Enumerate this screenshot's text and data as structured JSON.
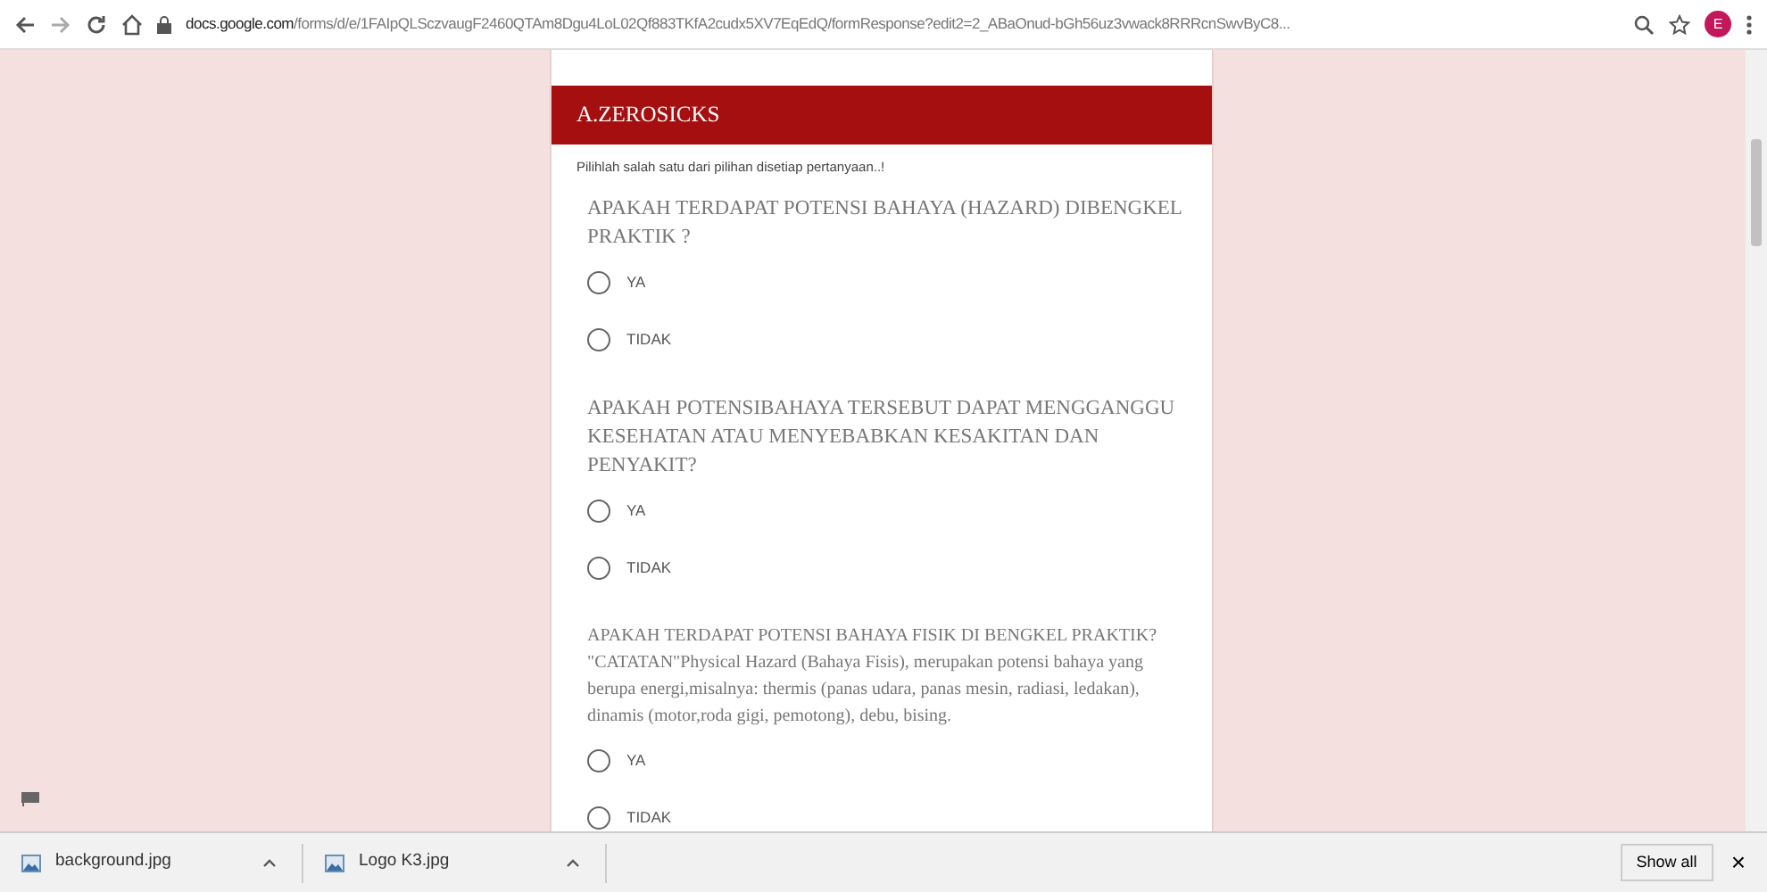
{
  "browser": {
    "url_host": "docs.google.com",
    "url_path": "/forms/d/e/1FAIpQLSczvaugF2460QTAm8Dgu4LoL02Qf883TKfA2cudx5XV7EqEdQ/formResponse?edit2=2_ABaOnud-bGh56uz3vwack8RRRcnSwvByC8...",
    "profile_initial": "E"
  },
  "form": {
    "section_title": "A.ZEROSICKS",
    "instruction": "Pilihlah salah satu dari pilihan disetiap pertanyaan..!",
    "questions": [
      {
        "text": "APAKAH TERDAPAT POTENSI BAHAYA (HAZARD) DIBENGKEL PRAKTIK ?",
        "options": [
          {
            "label": "YA",
            "selected": false
          },
          {
            "label": "TIDAK",
            "selected": false
          }
        ]
      },
      {
        "text": "APAKAH POTENSIBAHAYA TERSEBUT DAPAT MENGGANGGU KESEHATAN ATAU MENYEBABKAN KESAKITAN DAN PENYAKIT?",
        "options": [
          {
            "label": "YA",
            "selected": false
          },
          {
            "label": "TIDAK",
            "selected": false
          }
        ]
      },
      {
        "text": "APAKAH TERDAPAT POTENSI BAHAYA FISIK DI BENGKEL PRAKTIK? \"CATATAN\"Physical Hazard (Bahaya Fisis), merupakan potensi bahaya yang berupa energi,misalnya: thermis (panas udara, panas mesin, radiasi, ledakan), dinamis (motor,roda gigi, pemotong), debu, bising.",
        "options": [
          {
            "label": "YA",
            "selected": false
          },
          {
            "label": "TIDAK",
            "selected": false
          }
        ]
      }
    ]
  },
  "downloads": {
    "files": [
      {
        "name": "background.jpg"
      },
      {
        "name": "Logo K3.jpg"
      }
    ],
    "show_all": "Show all",
    "close": "×"
  }
}
